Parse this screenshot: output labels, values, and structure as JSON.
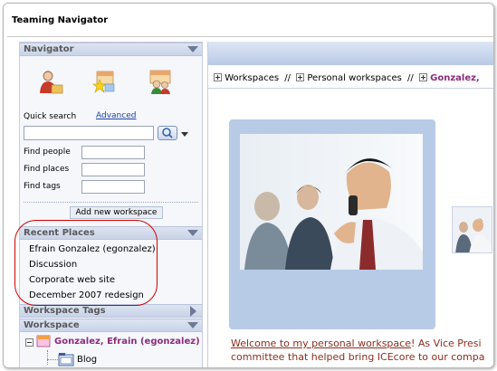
{
  "window": {
    "title": "Teaming Navigator"
  },
  "navigator": {
    "header": "Navigator",
    "icons": [
      "my-workspace-icon",
      "favorites-icon",
      "team-workspace-icon"
    ],
    "quick_search_label": "Quick search",
    "advanced_link": "Advanced",
    "search_value": "",
    "find_people_label": "Find people",
    "find_places_label": "Find places",
    "find_tags_label": "Find tags",
    "add_workspace_button": "Add new workspace"
  },
  "recent_places": {
    "header": "Recent Places",
    "items": [
      "Efrain Gonzalez (egonzalez)",
      "Discussion",
      "Corporate web site",
      "December 2007 redesign"
    ],
    "highlight_color": "#d20000"
  },
  "workspace_tags": {
    "header": "Workspace Tags"
  },
  "workspace": {
    "header": "Workspace",
    "tree_root": "Gonzalez, Efrain (egonzalez)",
    "tree_child": "Blog"
  },
  "breadcrumbs": {
    "items": [
      "Workspaces",
      "Personal workspaces",
      "Gonzalez,"
    ],
    "separator": "//"
  },
  "content": {
    "welcome_link": "Welcome to my personal workspace",
    "welcome_rest": "! As Vice Presi",
    "line2": "committee that helped bring ICEcore to our compa"
  },
  "colors": {
    "accent_purple": "#8b2c7c",
    "link_blue": "#1a3fa8",
    "header_blue": "#c9d3e8",
    "photo_frame": "#b7cbe6"
  }
}
